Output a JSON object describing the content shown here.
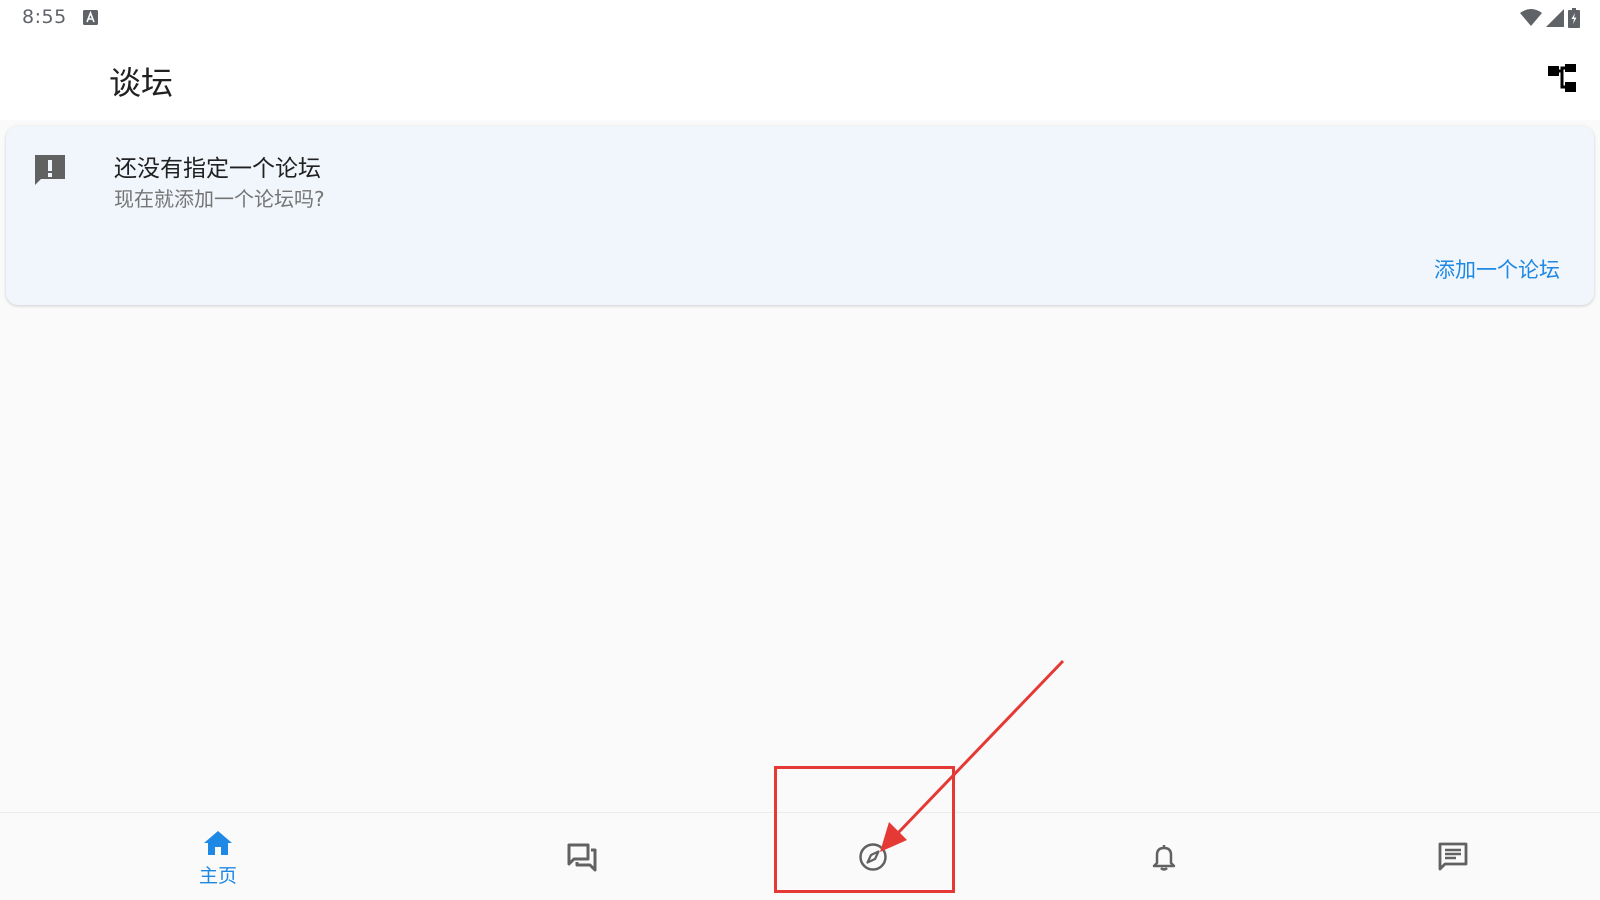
{
  "status_bar": {
    "time": "8:55",
    "icons": [
      "keyboard-a-icon",
      "wifi-icon",
      "signal-icon",
      "battery-charging-icon"
    ]
  },
  "app_bar": {
    "title": "谈坛",
    "action_icon": "sitemap-icon"
  },
  "banner": {
    "icon": "alert-message-icon",
    "title": "还没有指定一个论坛",
    "subtitle": "现在就添加一个论坛吗?",
    "action_label": "添加一个论坛"
  },
  "bottom_nav": {
    "items": [
      {
        "icon": "home-icon",
        "label": "主页",
        "active": true
      },
      {
        "icon": "discussions-icon",
        "active": false
      },
      {
        "icon": "compass-icon",
        "active": false
      },
      {
        "icon": "bell-icon",
        "active": false
      },
      {
        "icon": "message-icon",
        "active": false
      }
    ]
  },
  "colors": {
    "accent": "#1e88e5",
    "icon_gray": "#616161",
    "banner_bg": "#f1f6fc",
    "annotation_red": "#e53935",
    "background": "#fafafa"
  }
}
